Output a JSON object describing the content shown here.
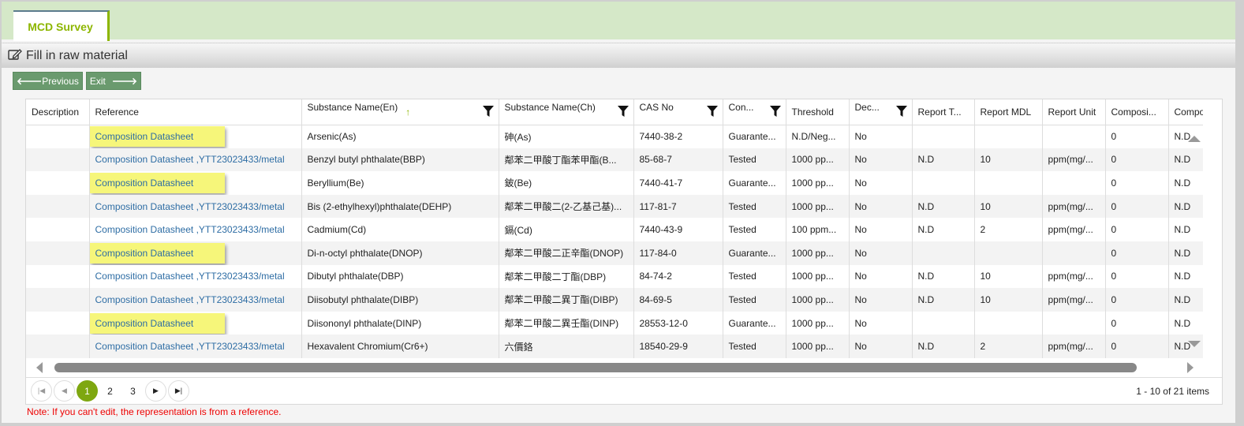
{
  "tab": {
    "label": "MCD Survey"
  },
  "title": {
    "icon": "edit-icon",
    "text": "Fill in raw material"
  },
  "toolbar": {
    "previous_label": "Previous",
    "exit_label": "Exit"
  },
  "grid": {
    "columns": [
      {
        "label": "Description",
        "filter": false
      },
      {
        "label": "Reference",
        "filter": false
      },
      {
        "label": "Substance Name(En)",
        "filter": true,
        "sort": "asc"
      },
      {
        "label": "Substance Name(Ch)",
        "filter": true
      },
      {
        "label": "CAS No",
        "filter": true
      },
      {
        "label": "Con...",
        "filter": true
      },
      {
        "label": "Threshold",
        "filter": false
      },
      {
        "label": "Dec...",
        "filter": true
      },
      {
        "label": "Report T...",
        "filter": false
      },
      {
        "label": "Report MDL",
        "filter": false
      },
      {
        "label": "Report Unit",
        "filter": false
      },
      {
        "label": "Composi...",
        "filter": false
      },
      {
        "label": "Compo",
        "filter": false
      }
    ],
    "rows": [
      {
        "description": "",
        "reference": "Composition Datasheet",
        "ref_highlight": true,
        "name_en": "Arsenic(As)",
        "name_ch": "砷(As)",
        "cas": "7440-38-2",
        "con": "Guarante...",
        "threshold": "N.D/Neg...",
        "dec": "No",
        "report_t": "",
        "report_mdl": "",
        "report_unit": "",
        "composi": "0",
        "compo": "N.D"
      },
      {
        "description": "",
        "reference": "Composition Datasheet ,YTT23023433/metal",
        "ref_highlight": false,
        "name_en": "Benzyl butyl phthalate(BBP)",
        "name_ch": "鄰苯二甲酸丁酯苯甲酯(B...",
        "cas": "85-68-7",
        "con": "Tested",
        "threshold": "1000 pp...",
        "dec": "No",
        "report_t": "N.D",
        "report_mdl": "10",
        "report_unit": "ppm(mg/...",
        "composi": "0",
        "compo": "N.D"
      },
      {
        "description": "",
        "reference": "Composition Datasheet",
        "ref_highlight": true,
        "name_en": "Beryllium(Be)",
        "name_ch": "鈹(Be)",
        "cas": "7440-41-7",
        "con": "Guarante...",
        "threshold": "1000 pp...",
        "dec": "No",
        "report_t": "",
        "report_mdl": "",
        "report_unit": "",
        "composi": "0",
        "compo": "N.D"
      },
      {
        "description": "",
        "reference": "Composition Datasheet ,YTT23023433/metal",
        "ref_highlight": false,
        "name_en": "Bis (2-ethylhexyl)phthalate(DEHP)",
        "name_ch": "鄰苯二甲酸二(2-乙基己基)...",
        "cas": "117-81-7",
        "con": "Tested",
        "threshold": "1000 pp...",
        "dec": "No",
        "report_t": "N.D",
        "report_mdl": "10",
        "report_unit": "ppm(mg/...",
        "composi": "0",
        "compo": "N.D"
      },
      {
        "description": "",
        "reference": "Composition Datasheet ,YTT23023433/metal",
        "ref_highlight": false,
        "name_en": "Cadmium(Cd)",
        "name_ch": "鎘(Cd)",
        "cas": "7440-43-9",
        "con": "Tested",
        "threshold": "100 ppm...",
        "dec": "No",
        "report_t": "N.D",
        "report_mdl": "2",
        "report_unit": "ppm(mg/...",
        "composi": "0",
        "compo": "N.D"
      },
      {
        "description": "",
        "reference": "Composition Datasheet",
        "ref_highlight": true,
        "name_en": "Di-n-octyl phthalate(DNOP)",
        "name_ch": "鄰苯二甲酸二正辛酯(DNOP)",
        "cas": "117-84-0",
        "con": "Guarante...",
        "threshold": "1000 pp...",
        "dec": "No",
        "report_t": "",
        "report_mdl": "",
        "report_unit": "",
        "composi": "0",
        "compo": "N.D"
      },
      {
        "description": "",
        "reference": "Composition Datasheet ,YTT23023433/metal",
        "ref_highlight": false,
        "name_en": "Dibutyl phthalate(DBP)",
        "name_ch": "鄰苯二甲酸二丁酯(DBP)",
        "cas": "84-74-2",
        "con": "Tested",
        "threshold": "1000 pp...",
        "dec": "No",
        "report_t": "N.D",
        "report_mdl": "10",
        "report_unit": "ppm(mg/...",
        "composi": "0",
        "compo": "N.D"
      },
      {
        "description": "",
        "reference": "Composition Datasheet ,YTT23023433/metal",
        "ref_highlight": false,
        "name_en": "Diisobutyl phthalate(DIBP)",
        "name_ch": "鄰苯二甲酸二異丁酯(DIBP)",
        "cas": "84-69-5",
        "con": "Tested",
        "threshold": "1000 pp...",
        "dec": "No",
        "report_t": "N.D",
        "report_mdl": "10",
        "report_unit": "ppm(mg/...",
        "composi": "0",
        "compo": "N.D"
      },
      {
        "description": "",
        "reference": "Composition Datasheet",
        "ref_highlight": true,
        "name_en": "Diisononyl phthalate(DINP)",
        "name_ch": "鄰苯二甲酸二異壬酯(DINP)",
        "cas": "28553-12-0",
        "con": "Guarante...",
        "threshold": "1000 pp...",
        "dec": "No",
        "report_t": "",
        "report_mdl": "",
        "report_unit": "",
        "composi": "0",
        "compo": "N.D"
      },
      {
        "description": "",
        "reference": "Composition Datasheet ,YTT23023433/metal",
        "ref_highlight": false,
        "name_en": "Hexavalent Chromium(Cr6+)",
        "name_ch": "六價鉻",
        "cas": "18540-29-9",
        "con": "Tested",
        "threshold": "1000 pp...",
        "dec": "No",
        "report_t": "N.D",
        "report_mdl": "2",
        "report_unit": "ppm(mg/...",
        "composi": "0",
        "compo": "N.D"
      }
    ]
  },
  "pager": {
    "pages": [
      "1",
      "2",
      "3"
    ],
    "current": "1",
    "info": "1 - 10 of 21 items"
  },
  "note": "Note: If you can't edit, the representation is from a reference.",
  "colors": {
    "accent": "#8db600",
    "tabbar": "#d5e8c8",
    "button": "#6a9a6e",
    "link": "#2e6da4",
    "highlight": "#f6f67a",
    "note": "#ee0000"
  }
}
